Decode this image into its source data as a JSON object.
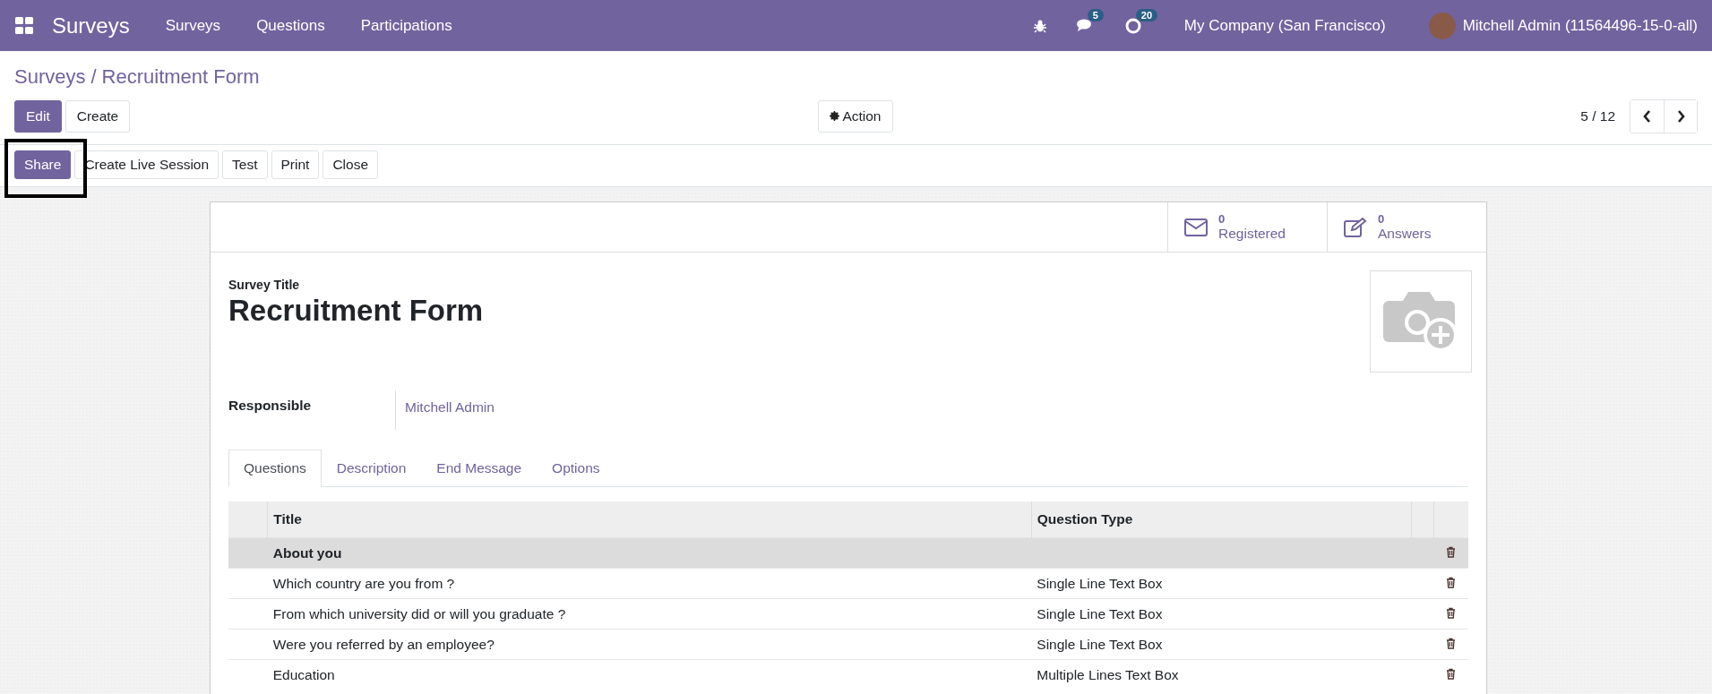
{
  "navbar": {
    "app_name": "Surveys",
    "menu": [
      "Surveys",
      "Questions",
      "Participations"
    ],
    "messages_count": "5",
    "activities_count": "20",
    "company": "My Company (San Francisco)",
    "user": "Mitchell Admin (11564496-15-0-all)"
  },
  "breadcrumb": {
    "parent": "Surveys",
    "separator": "/",
    "current": "Recruitment Form"
  },
  "actions": {
    "edit": "Edit",
    "create": "Create",
    "action": "Action",
    "pager": "5 / 12"
  },
  "header_buttons": [
    {
      "label": "Share",
      "primary": true,
      "highlighted": true
    },
    {
      "label": "Create Live Session",
      "primary": false,
      "highlighted": false
    },
    {
      "label": "Test",
      "primary": false,
      "highlighted": false
    },
    {
      "label": "Print",
      "primary": false,
      "highlighted": false
    },
    {
      "label": "Close",
      "primary": false,
      "highlighted": false
    }
  ],
  "stats": [
    {
      "kind": "envelope",
      "value": "0",
      "label": "Registered"
    },
    {
      "kind": "pencil",
      "value": "0",
      "label": "Answers"
    }
  ],
  "form": {
    "title_label": "Survey Title",
    "title": "Recruitment Form",
    "responsible_label": "Responsible",
    "responsible": "Mitchell Admin"
  },
  "tabs": [
    {
      "label": "Questions",
      "selected": true
    },
    {
      "label": "Description",
      "selected": false
    },
    {
      "label": "End Message",
      "selected": false
    },
    {
      "label": "Options",
      "selected": false
    }
  ],
  "table": {
    "columns": [
      "Title",
      "Question Type"
    ],
    "rows": [
      {
        "kind": "section",
        "title": "About you"
      },
      {
        "kind": "question",
        "title": "Which country are you from ?",
        "type": "Single Line Text Box"
      },
      {
        "kind": "question",
        "title": "From which university did or will you graduate ?",
        "type": "Single Line Text Box"
      },
      {
        "kind": "question",
        "title": "Were you referred by an employee?",
        "type": "Single Line Text Box"
      },
      {
        "kind": "question",
        "title": "Education",
        "type": "Multiple Lines Text Box"
      }
    ]
  }
}
